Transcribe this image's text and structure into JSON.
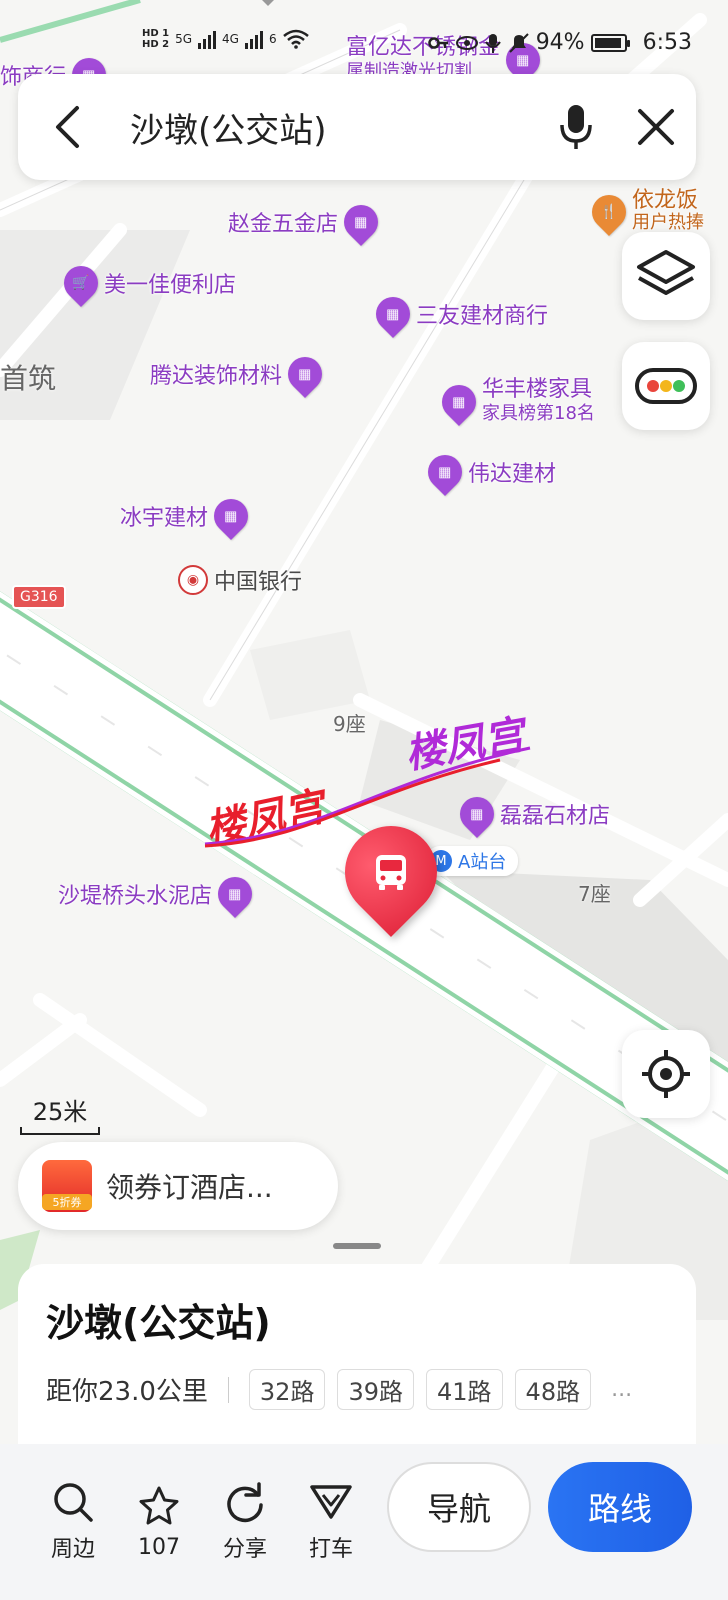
{
  "status_bar": {
    "hd1": "HD 1",
    "hd2": "HD 2",
    "net1": "5G",
    "net2": "4G",
    "wifi": "6",
    "battery_text": "94%",
    "battery_level": 0.94,
    "time": "6:53"
  },
  "search": {
    "title": "沙墩(公交站)"
  },
  "map": {
    "pois": [
      {
        "name": "赵金五金店"
      },
      {
        "name": "美一佳便利店"
      },
      {
        "name": "三友建材商行"
      },
      {
        "name": "腾达装饰材料"
      },
      {
        "name": "华丰楼家具"
      },
      {
        "name": "家具榜第18名"
      },
      {
        "name": "伟达建材"
      },
      {
        "name": "冰宇建材"
      },
      {
        "name": "磊磊石材店"
      },
      {
        "name": "沙堤桥头水泥店"
      },
      {
        "name": "依龙饭"
      },
      {
        "name": "用户热捧"
      },
      {
        "name": "富亿达不锈钢金"
      },
      {
        "name": "属制造激光切割"
      },
      {
        "name": "饰商行"
      }
    ],
    "bank": "中国银行",
    "labels": {
      "shouzhu": "首筑",
      "block9": "9座",
      "block7": "7座"
    },
    "road_badge": "G316",
    "watermark_red": "楼凤宫",
    "watermark_purple": "楼凤宫",
    "station_tag": "A站台",
    "station_marker": "M"
  },
  "scale": {
    "value": "25米"
  },
  "promo": {
    "badge": "5折券",
    "text": "领券订酒店..."
  },
  "sheet": {
    "name": "沙墩(公交站)",
    "distance": "距你23.0公里",
    "routes": [
      "32路",
      "39路",
      "41路",
      "48路"
    ],
    "more": "..."
  },
  "toolbar": {
    "nearby": "周边",
    "favorites_count": "107",
    "share": "分享",
    "taxi": "打车"
  },
  "actions": {
    "navigate": "导航",
    "route": "路线"
  }
}
